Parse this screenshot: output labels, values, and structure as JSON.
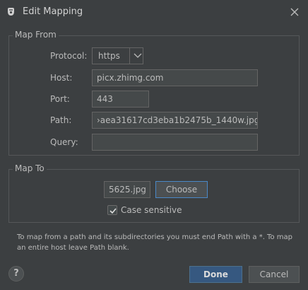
{
  "window": {
    "title": "Edit Mapping",
    "app_icon": "charles-app-icon",
    "close_icon": "close-icon"
  },
  "map_from": {
    "legend": "Map From",
    "protocol_label": "Protocol:",
    "protocol_value": "https",
    "host_label": "Host:",
    "host_value": "picx.zhimg.com",
    "port_label": "Port:",
    "port_value": "443",
    "path_label": "Path:",
    "path_value": "›aea31617cd3eba1b2475b_1440w.jpg",
    "query_label": "Query:",
    "query_value": ""
  },
  "map_to": {
    "legend": "Map To",
    "file_value": "5625.jpg",
    "choose_label": "Choose",
    "case_sensitive_label": "Case sensitive",
    "case_sensitive_checked": true
  },
  "help_text": "To map from a path and its subdirectories you must end Path with a *. To map an entire host leave Path blank.",
  "buttons": {
    "help": "?",
    "done": "Done",
    "cancel": "Cancel"
  }
}
